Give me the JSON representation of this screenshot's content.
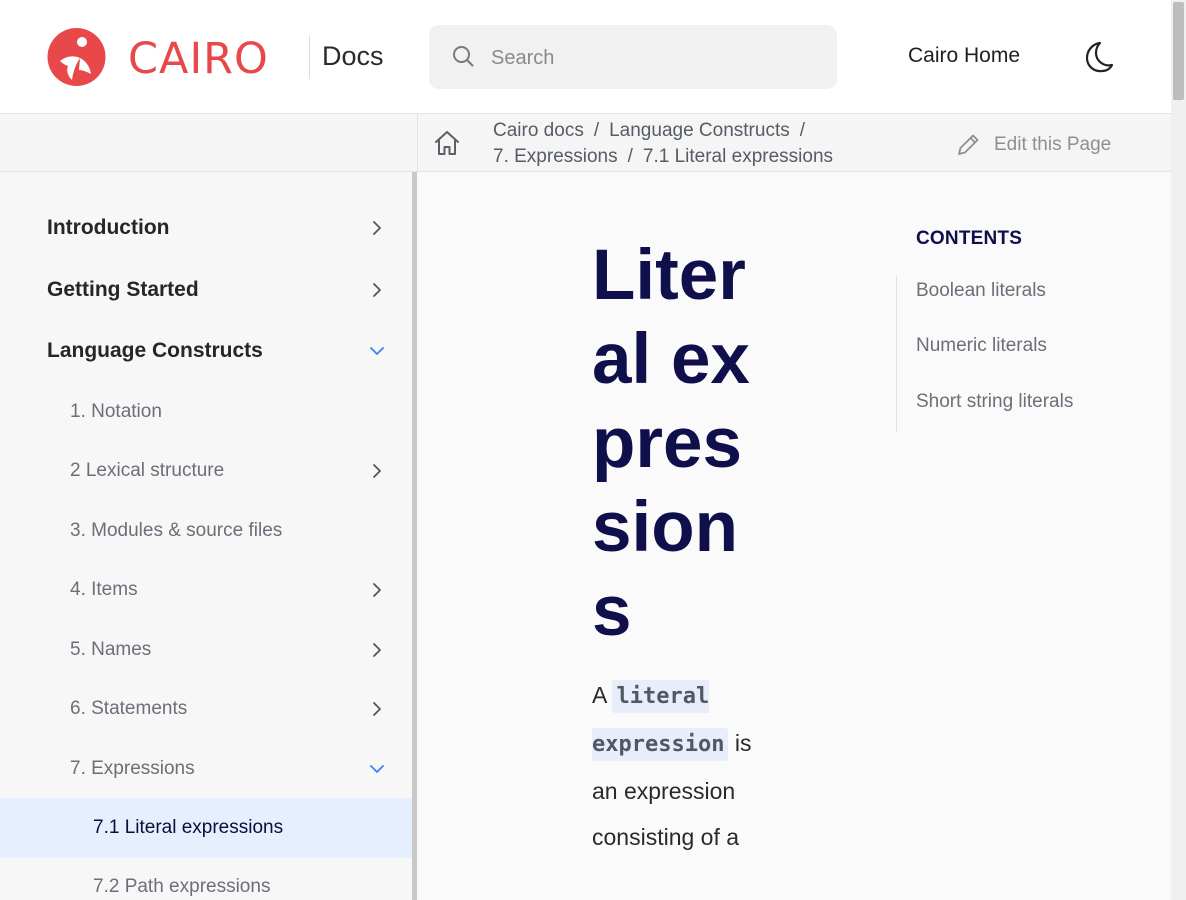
{
  "header": {
    "logo_text": "CAIRO",
    "logo_suffix": "Docs",
    "search_placeholder": "Search",
    "home_link": "Cairo Home",
    "theme_icon": "moon-icon",
    "brand_color": "#e8484a"
  },
  "breadcrumb": {
    "items": [
      "Cairo docs",
      "Language Constructs",
      "7. Expressions",
      "7.1 Literal expressions"
    ],
    "separator": "/",
    "edit_label": "Edit this Page"
  },
  "sidebar": {
    "items": [
      {
        "label": "Introduction",
        "level": 0,
        "chevron": "right"
      },
      {
        "label": "Getting Started",
        "level": 0,
        "chevron": "right"
      },
      {
        "label": "Language Constructs",
        "level": 0,
        "chevron": "down"
      },
      {
        "label": "1. Notation",
        "level": 1
      },
      {
        "label": "2 Lexical structure",
        "level": 1,
        "chevron": "right"
      },
      {
        "label": "3. Modules & source files",
        "level": 1
      },
      {
        "label": "4. Items",
        "level": 1,
        "chevron": "right"
      },
      {
        "label": "5. Names",
        "level": 1,
        "chevron": "right"
      },
      {
        "label": "6. Statements",
        "level": 1,
        "chevron": "right"
      },
      {
        "label": "7. Expressions",
        "level": 1,
        "chevron": "down"
      },
      {
        "label": "7.1 Literal expressions",
        "level": 2,
        "active": true
      },
      {
        "label": "7.2 Path expressions",
        "level": 2
      }
    ]
  },
  "main": {
    "title": "Literal expressions",
    "para_prefix": "A",
    "para_code": "literal expression",
    "para_suffix": "is an expression consisting of a"
  },
  "toc": {
    "heading": "CONTENTS",
    "links": [
      "Boolean literals",
      "Numeric literals",
      "Short string literals"
    ]
  }
}
